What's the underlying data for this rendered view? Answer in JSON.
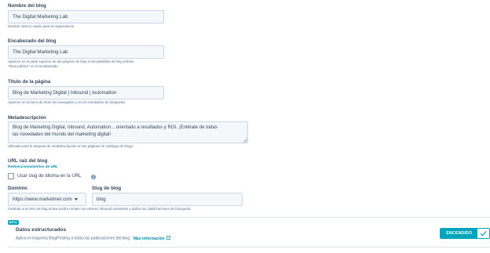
{
  "blog_name": {
    "label": "Nombre del blog",
    "value": "The Digital Marketing Lab",
    "help": "Nombre interno usado para la organización"
  },
  "blog_header": {
    "label": "Encabezado del blog",
    "value": "The Digital Marketing Lab",
    "help_line1": "Aparece en la parte superior de las páginas de blog si las plantillas de blog utilizan",
    "help_line2": "\"título público\" en el encabezado"
  },
  "page_title": {
    "label": "Título de la página",
    "value": "Blog de Marketing Digital | Inbound | Automation",
    "help": "Aparece en la barra de título del navegador y en los resultados de búsqueda"
  },
  "meta_description": {
    "label": "Metadescripción",
    "value_line1": "Blog de Marketing Digital, Inbound, Automation... orientado a resultados y ROI. ¡Entérate de todas",
    "value_line2": "las novedades del mundo del marketing digital!",
    "help": "Utilizado para la etiqueta de metadescripción en las páginas de catálogo de blogs"
  },
  "root_url": {
    "label": "URL raíz del blog",
    "redirect_link": "Redireccionamientos de URL",
    "language_slug_checkbox": "Usar slug de idioma en la URL",
    "info_icon": "info-icon",
    "domain_label": "Dominio",
    "domain_value": "https://www.marketinet.com",
    "slug_label": "Slug de blog",
    "slug_value": "blog",
    "help": "Cambiar una URL de blog activa podría romper tus enlaces inbound existentes y dañar tus clasificaciones de búsqueda"
  },
  "structured_data": {
    "badge": "BETA",
    "title": "Datos estructurados",
    "description": "Aplica el esquema BlogPosting a todas las publicaciones del blog.",
    "more_link": "Más información",
    "toggle_label": "ENCENDIDO",
    "toggle_state": "on"
  },
  "colors": {
    "accent": "#00a4bd",
    "link": "#0091ae",
    "text": "#33475b",
    "field_bg": "#f5f8fa",
    "border": "#cbd6e2"
  }
}
